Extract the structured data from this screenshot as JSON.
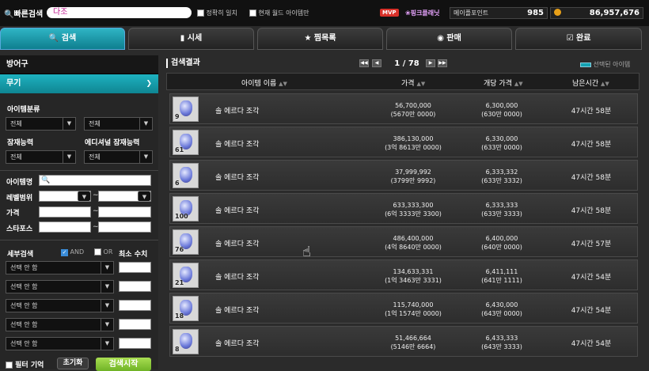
{
  "topbar": {
    "quick_search_label": "빠른검색",
    "quick_search_value": "다조",
    "exact_match_label": "정확히 일치",
    "current_world_label": "현재 월드 아이템만",
    "mvp_badge": "MVP",
    "grade_label": "핑크플래닛",
    "maple_points_label": "메이플포인트",
    "maple_points_value": "985",
    "meso_value": "86,957,676"
  },
  "tabs": [
    {
      "label": "검색",
      "icon": "search-icon",
      "active": true
    },
    {
      "label": "시세",
      "icon": "chart-icon"
    },
    {
      "label": "찜목록",
      "icon": "star-icon"
    },
    {
      "label": "판매",
      "icon": "coin-icon"
    },
    {
      "label": "완료",
      "icon": "check-box-icon"
    }
  ],
  "left": {
    "category_header": "방어구",
    "subcategory": "무기",
    "item_class_label": "아이템분류",
    "item_class_1": "전체",
    "item_class_2": "전체",
    "potential_label": "잠재능력",
    "additional_potential_label": "에디셔널 잠재능력",
    "potential_value": "전체",
    "additional_potential_value": "전체",
    "item_name_label": "아이템명",
    "level_range_label": "레벨범위",
    "price_label": "가격",
    "starforce_label": "스타포스",
    "range_sep": "~",
    "detail_search_label": "세부검색",
    "and_label": "AND",
    "or_label": "OR",
    "min_value_label": "최소 수치",
    "option_placeholder": "선택 안 함",
    "filter_memory_label": "필터 기억",
    "reset_button": "초기화",
    "search_start_button": "검색시작"
  },
  "results": {
    "title": "검색결과",
    "page_current": "1",
    "page_sep": "/",
    "page_total": "78",
    "selected_items_label": "선택된 아이템",
    "columns": {
      "name": "아이템 이름",
      "price": "가격",
      "unit_price": "개당 가격",
      "time_left": "남은시간"
    },
    "rows": [
      {
        "count": "9",
        "name": "솔 에르다 조각",
        "price": "56,700,000",
        "price_kr": "(5670만 0000)",
        "unit": "6,300,000",
        "unit_kr": "(630만 0000)",
        "time": "47시간 58분"
      },
      {
        "count": "61",
        "name": "솔 에르다 조각",
        "price": "386,130,000",
        "price_kr": "(3억 8613만 0000)",
        "unit": "6,330,000",
        "unit_kr": "(633만 0000)",
        "time": "47시간 58분"
      },
      {
        "count": "6",
        "name": "솔 에르다 조각",
        "price": "37,999,992",
        "price_kr": "(3799만 9992)",
        "unit": "6,333,332",
        "unit_kr": "(633만 3332)",
        "time": "47시간 58분"
      },
      {
        "count": "100",
        "name": "솔 에르다 조각",
        "price": "633,333,300",
        "price_kr": "(6억 3333만 3300)",
        "unit": "6,333,333",
        "unit_kr": "(633만 3333)",
        "time": "47시간 58분"
      },
      {
        "count": "76",
        "name": "솔 에르다 조각",
        "price": "486,400,000",
        "price_kr": "(4억 8640만 0000)",
        "unit": "6,400,000",
        "unit_kr": "(640만 0000)",
        "time": "47시간 57분"
      },
      {
        "count": "21",
        "name": "솔 에르다 조각",
        "price": "134,633,331",
        "price_kr": "(1억 3463만 3331)",
        "unit": "6,411,111",
        "unit_kr": "(641만 1111)",
        "time": "47시간 54분"
      },
      {
        "count": "18",
        "name": "솔 에르다 조각",
        "price": "115,740,000",
        "price_kr": "(1억 1574만 0000)",
        "unit": "6,430,000",
        "unit_kr": "(643만 0000)",
        "time": "47시간 54분"
      },
      {
        "count": "8",
        "name": "솔 에르다 조각",
        "price": "51,466,664",
        "price_kr": "(5146만 6664)",
        "unit": "6,433,333",
        "unit_kr": "(643만 3333)",
        "time": "47시간 54분"
      }
    ]
  },
  "colors": {
    "accent": "#14a3b3",
    "search_button": "#8fcf3a",
    "mvp": "#d9312a"
  }
}
